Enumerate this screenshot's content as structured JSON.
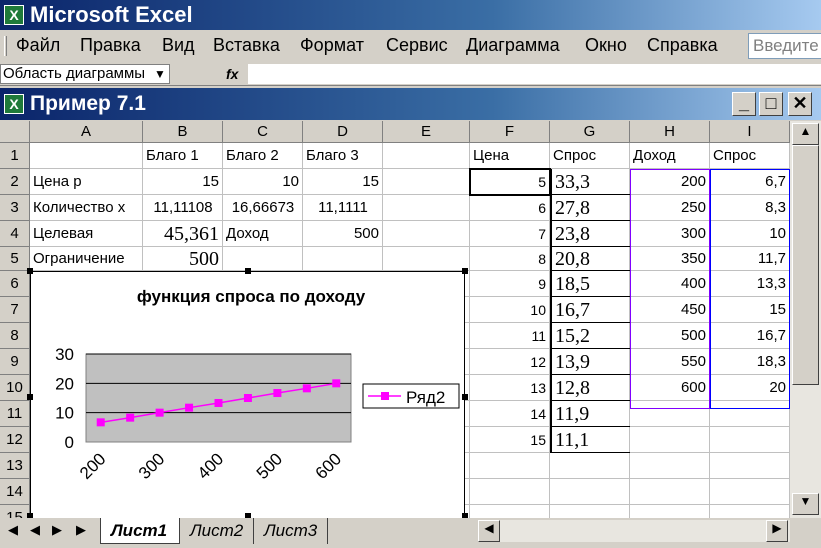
{
  "app": {
    "title": "Microsoft Excel",
    "icon_letter": "X"
  },
  "menu": [
    "Файл",
    "Правка",
    "Вид",
    "Вставка",
    "Формат",
    "Сервис",
    "Диаграмма",
    "Окно",
    "Справка"
  ],
  "help_box": "Введите вопрос",
  "name_box": "Область диаграммы",
  "fx_label": "fx",
  "workbook": {
    "title": "Пример 7.1"
  },
  "columns": [
    "A",
    "B",
    "C",
    "D",
    "E",
    "F",
    "G",
    "H",
    "I"
  ],
  "rows": [
    "1",
    "2",
    "3",
    "4",
    "5",
    "6",
    "7",
    "8",
    "9",
    "10",
    "11",
    "12",
    "13",
    "14",
    "15"
  ],
  "cells": {
    "B1": "Благо 1",
    "C1": "Благо 2",
    "D1": "Благо 3",
    "F1": "Цена",
    "G1": "Спрос",
    "H1": "Доход",
    "I1": "Спрос",
    "A2": "Цена р",
    "B2": "15",
    "C2": "10",
    "D2": "15",
    "A3": "Количество x",
    "B3": "11,11108",
    "C3": "16,66673",
    "D3": "11,1111",
    "A4": "Целевая",
    "B4": "45,361",
    "C4": "Доход",
    "D4": "500",
    "A5": "Ограничение",
    "B5": "500"
  },
  "f_values": [
    "5",
    "6",
    "7",
    "8",
    "9",
    "10",
    "11",
    "12",
    "13",
    "14",
    "15"
  ],
  "g_values": [
    "33,3",
    "27,8",
    "23,8",
    "20,8",
    "18,5",
    "16,7",
    "15,2",
    "13,9",
    "12,8",
    "11,9",
    "11,1"
  ],
  "h_values": [
    "200",
    "250",
    "300",
    "350",
    "400",
    "450",
    "500",
    "550",
    "600"
  ],
  "i_values": [
    "6,7",
    "8,3",
    "10",
    "11,7",
    "13,3",
    "15",
    "16,7",
    "18,3",
    "20"
  ],
  "chart_data": {
    "type": "line",
    "title": "функция спроса по доходу",
    "x": [
      200,
      250,
      300,
      350,
      400,
      450,
      500,
      550,
      600
    ],
    "x_tick_labels": [
      "200",
      "300",
      "400",
      "500",
      "600"
    ],
    "y_tick_labels": [
      "0",
      "10",
      "20",
      "30"
    ],
    "ylim": [
      0,
      30
    ],
    "series": [
      {
        "name": "Ряд2",
        "values": [
          6.7,
          8.3,
          10,
          11.7,
          13.3,
          15,
          16.7,
          18.3,
          20
        ],
        "color": "#ff00ff"
      }
    ],
    "plot_background": "#c0c0c0",
    "grid": true,
    "legend_position": "right"
  },
  "sheets": [
    "Лист1",
    "Лист2",
    "Лист3"
  ],
  "active_sheet": "Лист1"
}
